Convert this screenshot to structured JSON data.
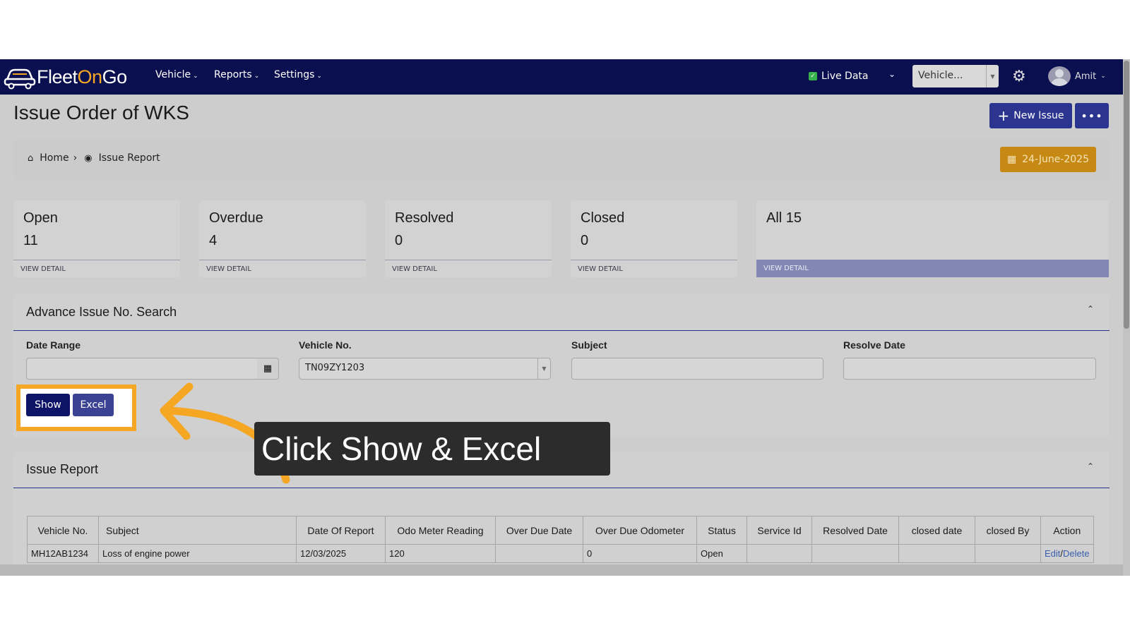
{
  "navbar": {
    "brand_part1": "Fleet",
    "brand_part2": "On",
    "brand_part3": "Go",
    "menu": [
      {
        "label": "Vehicle"
      },
      {
        "label": "Reports"
      },
      {
        "label": "Settings"
      }
    ],
    "live_data_label": "Live Data",
    "vehicle_select_value": "Vehicle...",
    "user_name": "Amit"
  },
  "page": {
    "title": "Issue Order of WKS",
    "new_issue_label": "New Issue",
    "more_label": "•••"
  },
  "breadcrumb": {
    "home": "Home",
    "current": "Issue Report",
    "date": "24-June-2025"
  },
  "stats": [
    {
      "title": "Open",
      "count": "11",
      "footer": "VIEW DETAIL"
    },
    {
      "title": "Overdue",
      "count": "4",
      "footer": "VIEW DETAIL"
    },
    {
      "title": "Resolved",
      "count": "0",
      "footer": "VIEW DETAIL"
    },
    {
      "title": "Closed",
      "count": "0",
      "footer": "VIEW DETAIL"
    },
    {
      "title": "All 15",
      "count": "",
      "footer": "VIEW DETAIL"
    }
  ],
  "search_panel": {
    "title": "Advance Issue No. Search",
    "date_range_label": "Date Range",
    "date_range_value": "",
    "vehicle_no_label": "Vehicle No.",
    "vehicle_no_value": "TN09ZY1203",
    "subject_label": "Subject",
    "subject_value": "",
    "resolve_date_label": "Resolve Date",
    "resolve_date_value": "",
    "show_label": "Show",
    "excel_label": "Excel"
  },
  "report_panel": {
    "title": "Issue Report",
    "columns": [
      "Vehicle No.",
      "Subject",
      "Date Of Report",
      "Odo Meter Reading",
      "Over Due Date",
      "Over Due Odometer",
      "Status",
      "Service Id",
      "Resolved Date",
      "closed date",
      "closed By",
      "Action"
    ],
    "rows": [
      {
        "vehicle_no": "MH12AB1234",
        "subject": "Loss of engine power",
        "date_of_report": "12/03/2025",
        "odo": "120",
        "over_due_date": "",
        "over_due_odometer": "0",
        "status": "Open",
        "service_id": "",
        "resolved_date": "",
        "closed_date": "",
        "closed_by": "",
        "action_edit": "Edit",
        "action_sep": "/",
        "action_delete": "Delete"
      }
    ]
  },
  "callout": {
    "text": "Click Show & Excel"
  },
  "colors": {
    "navbar": "#0a0f4f",
    "primary": "#2b3590",
    "date_button": "#c68a14",
    "highlight": "#f5a623",
    "callout_bg": "#2c2c2c"
  },
  "icons": [
    "car-logo-icon",
    "checkbox-icon",
    "chevron-down-icon",
    "gear-icon",
    "avatar-icon",
    "plus-icon",
    "home-icon",
    "dashboard-icon",
    "calendar-icon",
    "caret-up-icon",
    "arrow-icon"
  ]
}
